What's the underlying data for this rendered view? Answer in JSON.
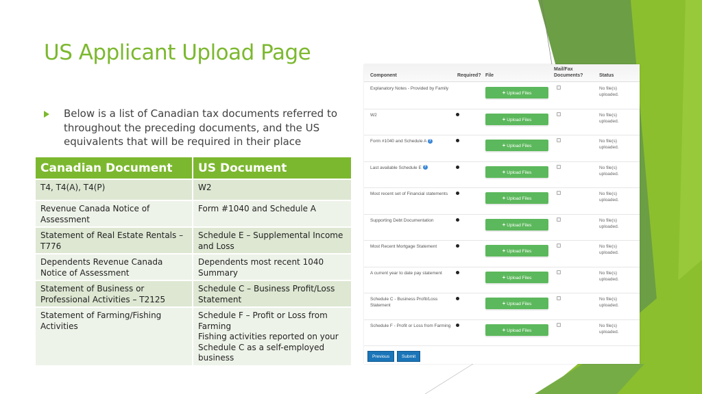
{
  "slide": {
    "title": "US Applicant Upload Page",
    "bullet": "Below is a list of Canadian tax documents referred to throughout the preceding documents, and the US equivalents that will be required in their place",
    "colors": {
      "accent": "#7cb82f",
      "row_odd": "#dde7d2",
      "row_even": "#eef3e9"
    }
  },
  "doc_table": {
    "headers": [
      "Canadian Document",
      "US Document"
    ],
    "rows": [
      [
        "T4, T4(A), T4(P)",
        "W2"
      ],
      [
        "Revenue Canada Notice of Assessment",
        "Form #1040 and Schedule A"
      ],
      [
        "Statement of Real Estate Rentals – T776",
        "Schedule E – Supplemental Income and Loss"
      ],
      [
        "Dependents Revenue Canada Notice of Assessment",
        "Dependents most recent 1040 Summary"
      ],
      [
        "Statement of Business or Professional Activities – T2125",
        "Schedule C – Business Profit/Loss Statement"
      ],
      [
        "Statement of Farming/Fishing Activities",
        "Schedule F – Profit or Loss from Farming\nFishing activities reported on your Schedule C as a self-employed business"
      ]
    ]
  },
  "upload_panel": {
    "headers": {
      "component": "Component",
      "required": "Required?",
      "file": "File",
      "mailfax": "Mail/Fax Documents?",
      "status": "Status"
    },
    "upload_label": "Upload Files",
    "upload_icon": "plus-icon",
    "required_icon": "asterisk-icon",
    "rows": [
      {
        "component": "Explanatory Notes - Provided by Family",
        "required": false,
        "info": false,
        "mail_fax": false,
        "status": "No file(s) uploaded."
      },
      {
        "component": "W2",
        "required": true,
        "info": false,
        "mail_fax": false,
        "status": "No file(s) uploaded."
      },
      {
        "component": "Form #1040 and Schedule A",
        "required": true,
        "info": true,
        "mail_fax": false,
        "status": "No file(s) uploaded."
      },
      {
        "component": "Last available Schedule E",
        "required": true,
        "info": true,
        "mail_fax": false,
        "status": "No file(s) uploaded."
      },
      {
        "component": "Most recent set of Financial statements",
        "required": true,
        "info": false,
        "mail_fax": false,
        "status": "No file(s) uploaded."
      },
      {
        "component": "Supporting Debt Documentation",
        "required": true,
        "info": false,
        "mail_fax": false,
        "status": "No file(s) uploaded."
      },
      {
        "component": "Most Recent Mortgage Statement",
        "required": true,
        "info": false,
        "mail_fax": false,
        "status": "No file(s) uploaded."
      },
      {
        "component": "A current year to date pay statement",
        "required": true,
        "info": false,
        "mail_fax": false,
        "status": "No file(s) uploaded."
      },
      {
        "component": "Schedule C - Business Profit/Loss Statement",
        "required": true,
        "info": false,
        "mail_fax": false,
        "status": "No file(s) uploaded."
      },
      {
        "component": "Schedule F - Profit or Loss from Farming",
        "required": true,
        "info": false,
        "mail_fax": false,
        "status": "No file(s) uploaded."
      }
    ],
    "buttons": {
      "previous": "Previous",
      "submit": "Submit"
    },
    "colors": {
      "upload": "#5cb85c",
      "nav": "#1b75b8",
      "info": "#3a87d6"
    }
  }
}
